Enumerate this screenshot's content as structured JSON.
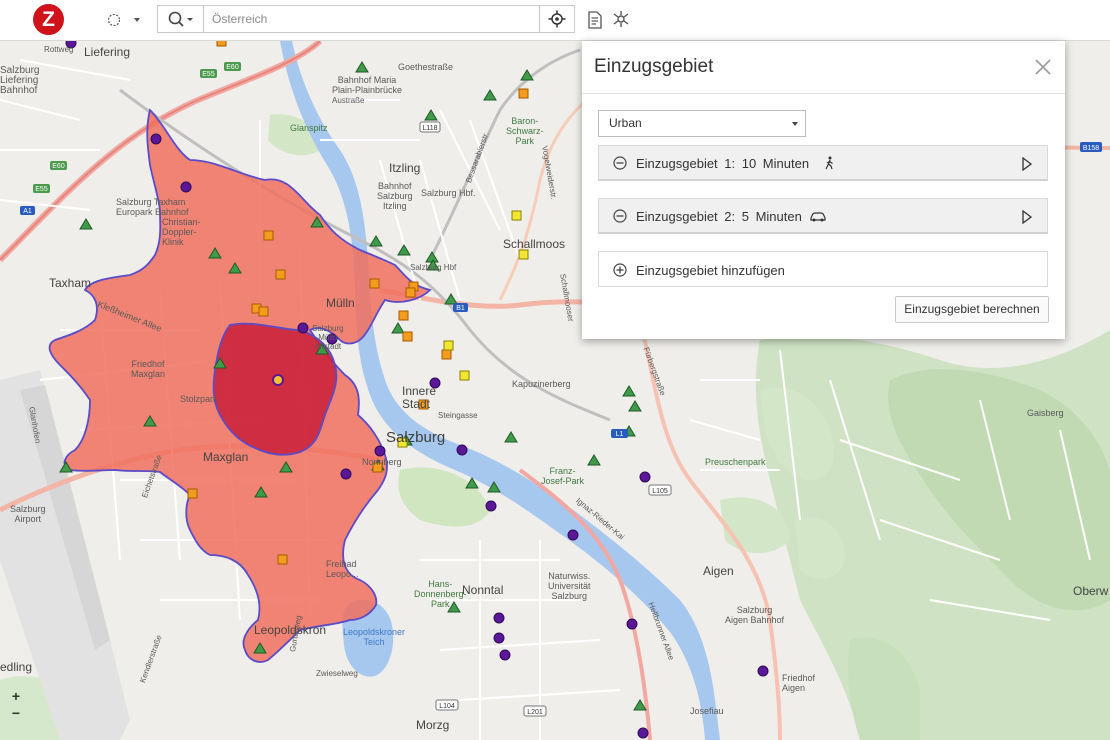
{
  "app": {
    "logo_letter": "Z"
  },
  "toolbar": {
    "search_placeholder": "Österreich",
    "icons": [
      "lasso-select-icon",
      "search-icon",
      "chevron-down-icon",
      "locate-icon",
      "report-icon",
      "poi-icon"
    ]
  },
  "map": {
    "labels": {
      "liefering": "Liefering",
      "salzburg_liefering_bahnhof": [
        "Salzburg",
        "Liefering",
        "Bahnhof"
      ],
      "rottweg": "Rottweg",
      "goethestrasse": "Goethestraße",
      "bahnhof_maria_plain": [
        "Bahnhof Maria",
        "Plain-Plainbrücke"
      ],
      "austrasse": "Austraße",
      "glanspitz": "Glanspitz",
      "baron_schwarz_park": [
        "Baron-",
        "Schwarz-",
        "Park"
      ],
      "itzling": "Itzling",
      "salzburg_itzling": [
        "Bahnhof",
        "Salzburg",
        "Itzling"
      ],
      "salzburg_hbf_top": "Salzburg Hbf.",
      "salzburg_taxham": [
        "Salzburg Taxham",
        "Europark Bahnhof"
      ],
      "christian_doppler": [
        "Christian-",
        "Doppler-",
        "Klinik"
      ],
      "schallmoos": "Schallmoos",
      "taxham": "Taxham",
      "salzburg_hbf": "Salzburg Hbf",
      "muelln": "Mülln",
      "salzburg_muelln": [
        "Salzburg",
        "Mülln",
        "Altstadt"
      ],
      "klessheimer_allee": "Kleßheimer Allee",
      "friedhof_maxglan": [
        "Friedhof",
        "Maxglan"
      ],
      "stolzpark": "Stolzpark",
      "kapuzinerberg": "Kapuzinerberg",
      "innere_stadt": [
        "Innere",
        "Stadt"
      ],
      "steingasse": "Steingasse",
      "salzburg": "Salzburg",
      "maxglan": "Maxglan",
      "nonnberg": "Nonnberg",
      "franz_josef_park": [
        "Franz-",
        "Josef-Park"
      ],
      "preuschenpark": "Preuschenpark",
      "gaisberg": "Gaisberg",
      "salzburg_airport": [
        "Salzburg",
        "Airport"
      ],
      "eichetstrasse": "Eichetstraße",
      "freibad": [
        "Freibad",
        "Leopo..."
      ],
      "hans_donnenberg_park": [
        "Hans-",
        "Donnenberg-",
        "Park"
      ],
      "nonntal": "Nonntal",
      "naturwiss": [
        "Naturwiss.",
        "Universität",
        "Salzburg"
      ],
      "aigen": "Aigen",
      "salzburg_aigen_bahnhof": [
        "Salzburg",
        "Aigen Bahnhof"
      ],
      "leopoldskron": "Leopoldskron",
      "leopoldskroner_teich": [
        "Leopoldskroner",
        "Teich"
      ],
      "oberw": "Oberw",
      "friedhof_aigen": [
        "Friedhof",
        "Aigen"
      ],
      "josefiau": "Josefiau",
      "morzg": "Morzg",
      "edling": "edling",
      "kendlerstrasse": "Kendlerstraße",
      "zwieselweg": "Zwieselweg",
      "fuerbergstrasse": "Fürbergstraße",
      "hellbrunner": "Hellbrunner Allee",
      "ignaz_rieder_kai": "Ignaz-Rieder-Kai",
      "glanhofen": "Glanhofen",
      "bessarabierstrasse": "Bessarabierstr.",
      "guettatweg": "Gurtatweg",
      "schallmooser": "Schallmooser",
      "vogelweiderstrasse": "Vogelweiderstr."
    },
    "shields": [
      "E55",
      "E60",
      "L118",
      "E60",
      "E55",
      "A1",
      "B1",
      "B158",
      "L105",
      "L104",
      "L201",
      "L1"
    ],
    "zoom": {
      "in": "+",
      "out": "−"
    }
  },
  "panel": {
    "title": "Einzugsgebiet",
    "mode_value": "Urban",
    "rows": [
      {
        "text": "Einzugsgebiet  1:  10  Minuten",
        "mode_icon": "walk-icon"
      },
      {
        "text": "Einzugsgebiet  2:  5  Minuten",
        "mode_icon": "car-icon"
      }
    ],
    "add_label": "Einzugsgebiet hinzufügen",
    "calc_label": "Einzugsgebiet berechnen"
  },
  "colors": {
    "area_1": "#f0705e",
    "area_2": "#c9203a",
    "outline": "#5a4bc9",
    "marker_triangle": "#3f9a4a",
    "marker_circle": "#5a1797",
    "marker_square_orange": "#f49c1e",
    "marker_square_yellow": "#f2e632",
    "river": "#a7c8ee"
  }
}
